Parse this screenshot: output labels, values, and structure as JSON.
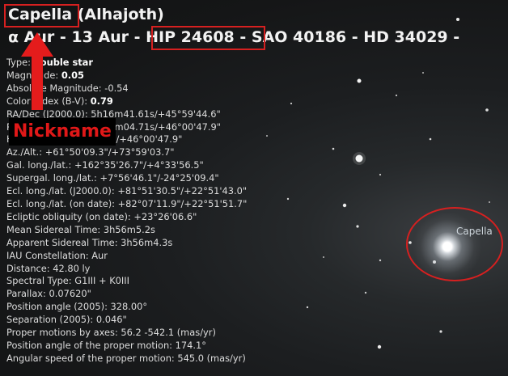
{
  "header": {
    "name": "Capella",
    "alt_name": "(Alhajoth)",
    "designation_prefix": "α Aur - 13 Aur - ",
    "hip": "HIP 24608",
    "designation_suffix": " - SAO 40186 - HD 34029 - "
  },
  "annotation": {
    "nickname_label": "Nickname",
    "accent_color": "#d62020",
    "sky_label": "Capella"
  },
  "info": {
    "type_label": "Type: ",
    "type_value": "double star",
    "magnitude_label": "Magnitude: ",
    "magnitude_value": "0.05",
    "abs_magnitude": "Absolute Magnitude: -0.54",
    "color_index_label": "Color Index (B-V): ",
    "color_index_value": "0.79",
    "radec_j2000": "RA/Dec (J2000.0): 5h16m41.61s/+45°59'44.6\"",
    "radec_date": "RA/Dec (on date): 5h18m04.71s/+46°00'47.9\"",
    "hadec": "HA/Dec: 22h40m00.24s/+46°00'47.9\"",
    "azalt": "Az./Alt.: +61°50'09.3\"/+73°59'03.7\"",
    "gal": "Gal. long./lat.: +162°35'26.7\"/+4°33'56.5\"",
    "supergal": "Supergal. long./lat.: +7°56'46.1\"/-24°25'09.4\"",
    "ecl_j2000": "Ecl. long./lat. (J2000.0): +81°51'30.5\"/+22°51'43.0\"",
    "ecl_date": "Ecl. long./lat. (on date): +82°07'11.9\"/+22°51'51.7\"",
    "ecl_obliquity": "Ecliptic obliquity (on date): +23°26'06.6\"",
    "mean_sidereal": "Mean Sidereal Time: 3h56m5.2s",
    "apparent_sidereal": "Apparent Sidereal Time: 3h56m4.3s",
    "constellation": "IAU Constellation: Aur",
    "distance": "Distance: 42.80 ly",
    "spectral": "Spectral Type: G1III + K0III",
    "parallax": "Parallax: 0.07620\"",
    "position_angle": "Position angle (2005): 328.00°",
    "separation": "Separation (2005): 0.046\"",
    "proper_motions": "Proper motions by axes: 56.2 -542.1 (mas/yr)",
    "pm_angle": "Position angle of the proper motion: 174.1°",
    "pm_speed": "Angular speed of the proper motion: 545.0 (mas/yr)"
  }
}
